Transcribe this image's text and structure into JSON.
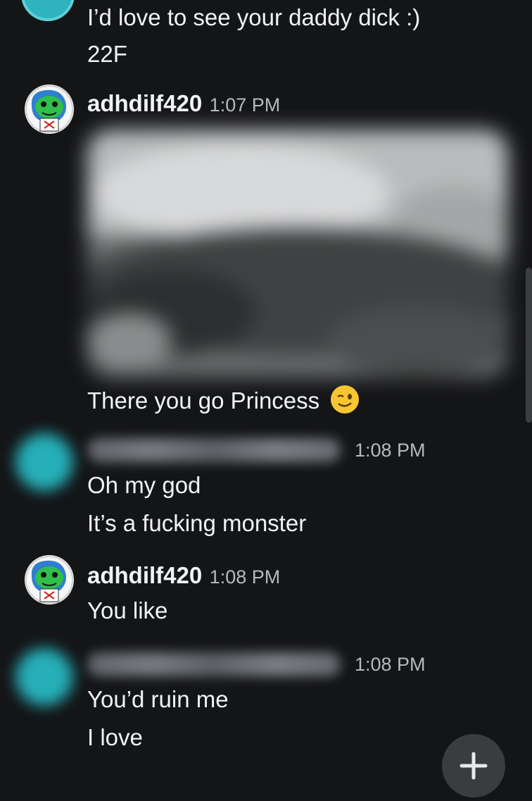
{
  "messages": [
    {
      "text_lines": [
        "I’d love to see your daddy dick :)",
        "22F"
      ]
    },
    {
      "username": "adhdilf420",
      "timestamp": "1:07 PM",
      "image_caption": "There you go Princess",
      "emoji": "winking-face"
    },
    {
      "timestamp": "1:08 PM",
      "text_lines": [
        "Oh my god",
        "It’s a fucking monster"
      ]
    },
    {
      "username": "adhdilf420",
      "timestamp": "1:08 PM",
      "text_lines": [
        "You like"
      ]
    },
    {
      "timestamp": "1:08 PM",
      "text_lines": [
        "You’d ruin me",
        "I love"
      ]
    }
  ],
  "fab": {
    "icon": "plus-icon"
  },
  "colors": {
    "background": "#141517",
    "text": "#f2f3f5",
    "timestamp": "#b5bac1",
    "avatar_teal": "#27b8c2"
  }
}
